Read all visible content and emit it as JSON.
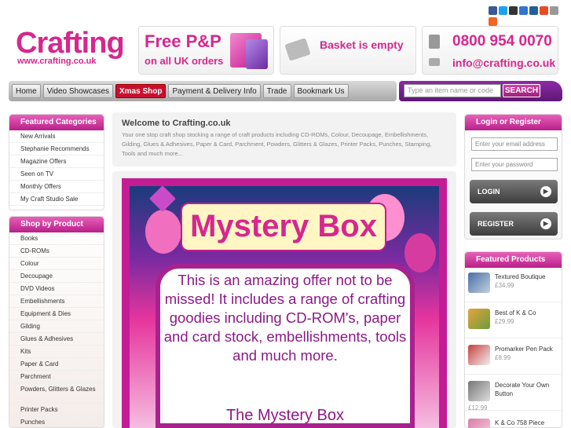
{
  "logo": {
    "title": "Crafting",
    "url": "www.crafting.co.uk"
  },
  "banners": {
    "postage": {
      "line1": "Free P&P",
      "line2": "on all UK orders"
    },
    "basket": {
      "text": "Basket is empty"
    },
    "contact": {
      "phone": "0800 954 0070",
      "email": "info@crafting.co.uk"
    }
  },
  "social_icons": [
    "facebook-icon",
    "twitter-icon",
    "myspace-icon",
    "delicious-icon",
    "digg-icon",
    "stumbleupon-icon",
    "email-icon",
    "plus-icon"
  ],
  "social_colors": [
    "#3b5998",
    "#1da1f2",
    "#333333",
    "#3274d1",
    "#235f9c",
    "#eb4924",
    "#999999",
    "#f26522"
  ],
  "nav": {
    "items": [
      "Home",
      "Video Showcases",
      "Xmas Shop",
      "Payment & Delivery Info",
      "Trade",
      "Bookmark Us"
    ],
    "search_placeholder": "Type an item name or code",
    "search_button": "SEARCH"
  },
  "featured_categories": {
    "title": "Featured Categories",
    "items": [
      "New Arrivals",
      "Stephanie Recommends",
      "Magazine Offers",
      "Seen on TV",
      "Monthly Offers",
      "My Craft Studio Sale"
    ]
  },
  "shop_by_product": {
    "title": "Shop by Product",
    "items": [
      "Books",
      "CD-ROMs",
      "Colour",
      "Decoupage",
      "DVD Videos",
      "Embellishments",
      "Equipment & Dies",
      "Gilding",
      "Glues & Adhesives",
      "Kits",
      "Paper & Card",
      "Parchment",
      "Powders, Glitters & Glazes",
      "Printer Packs",
      "Punches"
    ]
  },
  "welcome": {
    "title": "Welcome to Crafting.co.uk",
    "body": "Your one stop craft shop stocking a range of craft products including CD-ROMs, Colour, Decoupage, Embellishments, Gilding, Glues & Adhesives, Paper & Card, Parchment, Powders, Glitters & Glazes, Printer Packs, Punches, Stamping, Tools and much more..."
  },
  "mystery": {
    "title": "Mystery Box",
    "text": "This is an amazing offer not to be missed! It includes a range of crafting goodies including CD-ROM's, paper and card stock, embellishments, tools and much more.",
    "subtitle": "The Mystery Box"
  },
  "login": {
    "title": "Login or Register",
    "email_placeholder": "Enter your email address",
    "password_placeholder": "Enter your password",
    "login_button": "LOGIN",
    "register_button": "REGISTER"
  },
  "featured_products": {
    "title": "Featured Products",
    "items": [
      {
        "name": "Textured Boutique",
        "price": "£34.99"
      },
      {
        "name": "Best of K & Co",
        "price": "£29.99"
      },
      {
        "name": "Promarker Pen Pack",
        "price": "£8.99"
      },
      {
        "name": "Decorate Your Own Button",
        "price": "£12.99"
      },
      {
        "name": "K & Co 758 Piece",
        "price": ""
      }
    ]
  }
}
